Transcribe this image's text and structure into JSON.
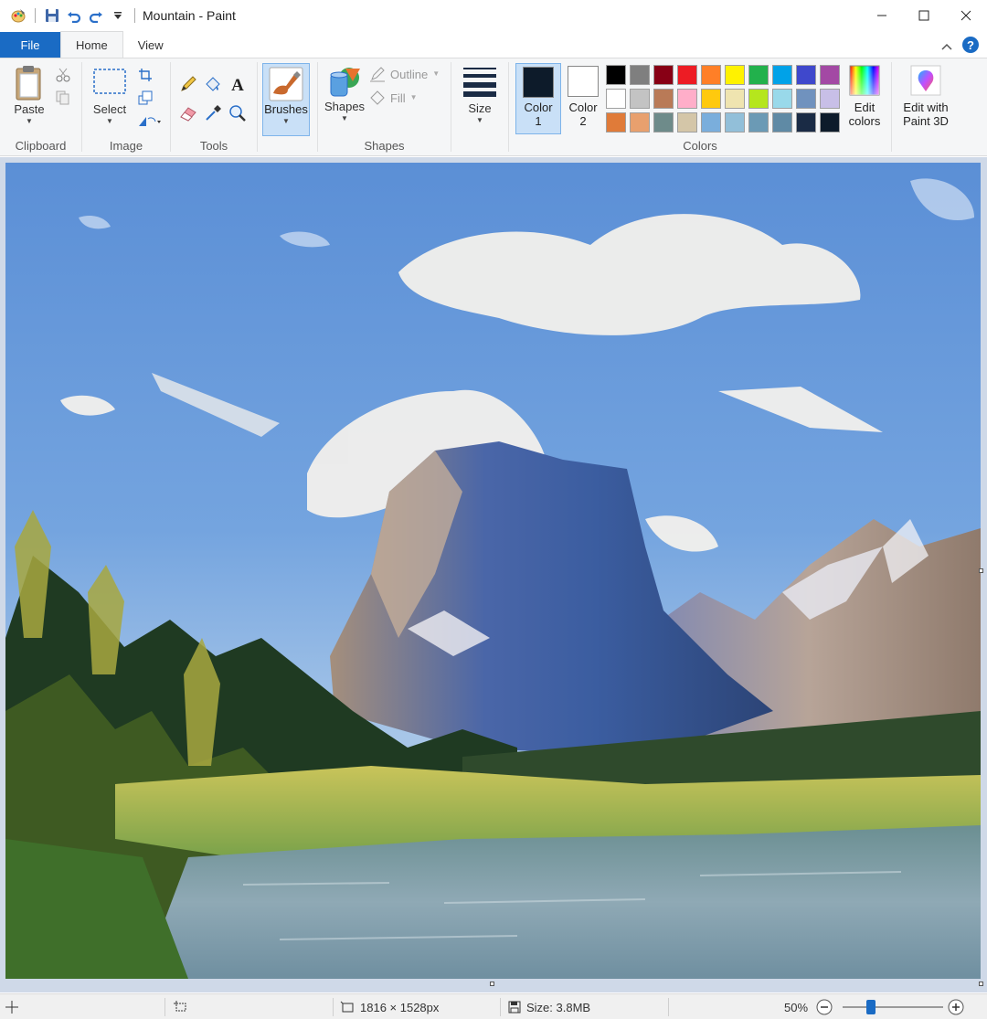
{
  "window": {
    "title": "Mountain - Paint"
  },
  "tabs": {
    "file": "File",
    "home": "Home",
    "view": "View"
  },
  "ribbon": {
    "clipboard": {
      "paste": "Paste",
      "group": "Clipboard"
    },
    "image": {
      "select": "Select",
      "group": "Image"
    },
    "tools": {
      "group": "Tools"
    },
    "brushes": {
      "label": "Brushes"
    },
    "shapes": {
      "label": "Shapes",
      "outline": "Outline",
      "fill": "Fill",
      "group": "Shapes"
    },
    "size": {
      "label": "Size"
    },
    "colors": {
      "color1_label": "Color 1",
      "color1_num": "1",
      "color1_word": "Color",
      "color2_word": "Color",
      "color2_num": "2",
      "color1_value": "#0d1b2a",
      "color2_value": "#ffffff",
      "edit_colors_line1": "Edit",
      "edit_colors_line2": "colors",
      "paint3d_line1": "Edit with",
      "paint3d_line2": "Paint 3D",
      "group": "Colors",
      "palette": [
        "#000000",
        "#7f7f7f",
        "#880015",
        "#ed1c24",
        "#ff7f27",
        "#fff200",
        "#22b14c",
        "#00a2e8",
        "#3f48cc",
        "#a349a4",
        "#ffffff",
        "#c3c3c3",
        "#b97a57",
        "#ffaec9",
        "#ffc90e",
        "#efe4b0",
        "#b5e61d",
        "#99d9ea",
        "#7092be",
        "#c8bfe7",
        "#e07b39",
        "#e8a06e",
        "#6e8b8a",
        "#d4c6a8",
        "#7aaedc",
        "#92bfd9",
        "#6b9ab5",
        "#5f8aa5",
        "#1a2b45",
        "#0d1b2a"
      ]
    }
  },
  "status": {
    "dimensions": "1816 × 1528px",
    "size": "Size: 3.8MB",
    "zoom": "50%",
    "zoom_level": 0.5
  }
}
